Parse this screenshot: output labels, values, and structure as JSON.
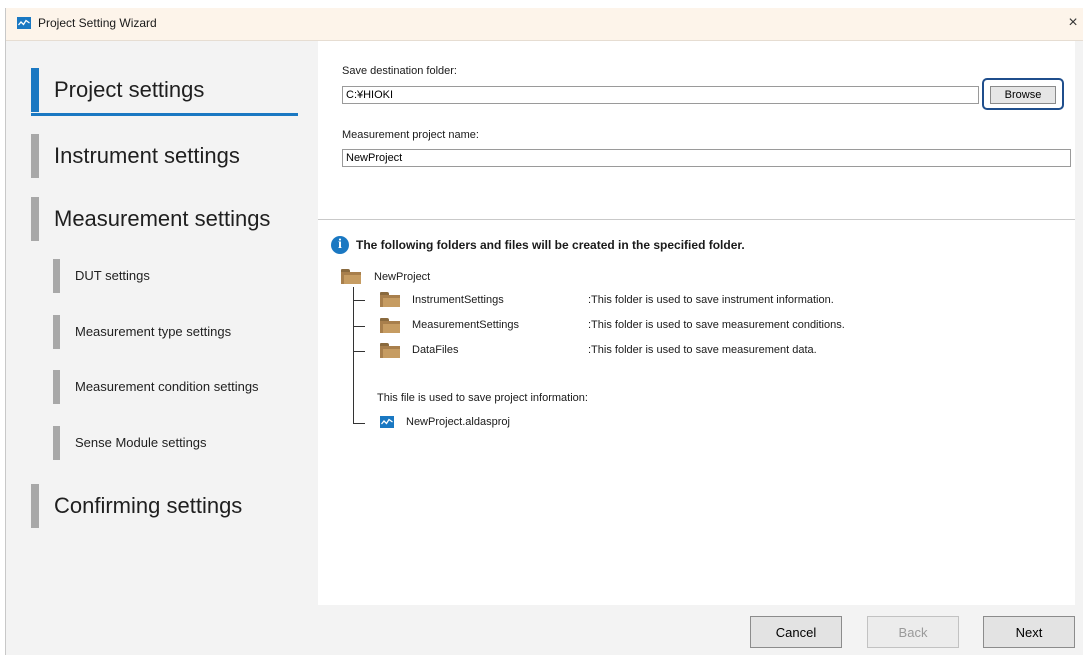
{
  "window": {
    "title": "Project Setting Wizard",
    "close_glyph": "×"
  },
  "sidebar": {
    "items": [
      {
        "label": "Project settings",
        "active": true
      },
      {
        "label": "Instrument settings"
      },
      {
        "label": "Measurement settings"
      },
      {
        "label": "Confirming settings"
      }
    ],
    "sub_items": [
      {
        "label": "DUT settings"
      },
      {
        "label": "Measurement type settings"
      },
      {
        "label": "Measurement condition settings"
      },
      {
        "label": "Sense Module settings"
      }
    ]
  },
  "form": {
    "save_folder_label": "Save destination folder:",
    "save_folder_value": "C:¥HIOKI",
    "browse_label": "Browse",
    "project_name_label": "Measurement project name:",
    "project_name_value": "NewProject"
  },
  "info": {
    "message": "The following folders and files will be created in the specified folder.",
    "icon": "info-icon"
  },
  "tree": {
    "root": "NewProject",
    "folders": [
      {
        "name": "InstrumentSettings",
        "desc": ":This folder is used to save instrument information."
      },
      {
        "name": "MeasurementSettings",
        "desc": ":This folder is used to save measurement conditions."
      },
      {
        "name": "DataFiles",
        "desc": ":This folder is used to save measurement data."
      }
    ],
    "file_caption": "This file is used to save project information:",
    "file_name": "NewProject.aldasproj"
  },
  "footer": {
    "cancel": "Cancel",
    "back": "Back",
    "next": "Next"
  },
  "colors": {
    "accent": "#1a78c2",
    "highlight_border": "#1f4e8c",
    "folder": "#c69c62"
  }
}
